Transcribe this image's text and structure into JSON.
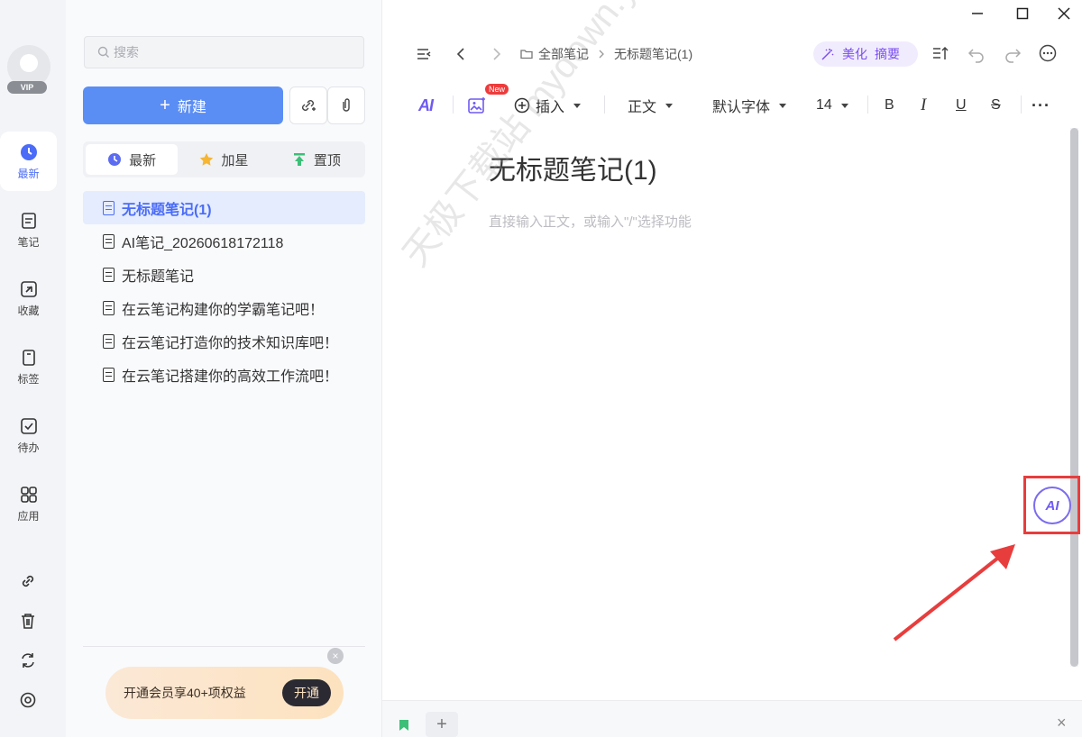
{
  "rail": {
    "vip_badge": "VIP",
    "items": [
      {
        "label": "最新",
        "icon": "clock-icon"
      },
      {
        "label": "笔记",
        "icon": "note-icon"
      },
      {
        "label": "收藏",
        "icon": "favorite-icon"
      },
      {
        "label": "标签",
        "icon": "tag-icon"
      },
      {
        "label": "待办",
        "icon": "todo-icon"
      },
      {
        "label": "应用",
        "icon": "apps-icon"
      }
    ],
    "tools": [
      "link-icon",
      "trash-icon",
      "sync-icon",
      "settings-icon"
    ]
  },
  "panel": {
    "search_placeholder": "搜索",
    "new_button": "新建",
    "new_plus": "+",
    "tabs": [
      {
        "label": "最新",
        "icon": "clock-icon",
        "color": "#5b6cf2"
      },
      {
        "label": "加星",
        "icon": "star-icon",
        "color": "#f6b533"
      },
      {
        "label": "置顶",
        "icon": "pin-top-icon",
        "color": "#3cbf78"
      }
    ],
    "notes": [
      "无标题笔记(1)",
      "AI笔记_20260618172118",
      "无标题笔记",
      "在云笔记构建你的学霸笔记吧！",
      "在云笔记打造你的技术知识库吧！",
      "在云笔记搭建你的高效工作流吧！"
    ],
    "promo": {
      "text": "开通会员享40+项权益",
      "button": "开通",
      "close": "×"
    }
  },
  "editor": {
    "breadcrumb": {
      "root": "全部笔记",
      "current": "无标题笔记(1)"
    },
    "beautify": "美化",
    "summary": "摘要",
    "toolbar": {
      "ai": "AI",
      "new_badge": "New",
      "insert": "插入",
      "style": "正文",
      "font": "默认字体",
      "size": "14",
      "bold": "B",
      "italic": "I",
      "underline": "U",
      "strike": "S",
      "more": "···"
    },
    "title": "无标题笔记(1)",
    "placeholder": "直接输入正文，或输入\"/\"选择功能",
    "watermark": "天极下载站 mydown.yesky.com",
    "ai_float": "AI",
    "bottom_plus": "+",
    "bottom_close": "×"
  },
  "colors": {
    "accent": "#5b8ef5",
    "ai": "#6f5af2",
    "highlight": "#e83d3d"
  }
}
